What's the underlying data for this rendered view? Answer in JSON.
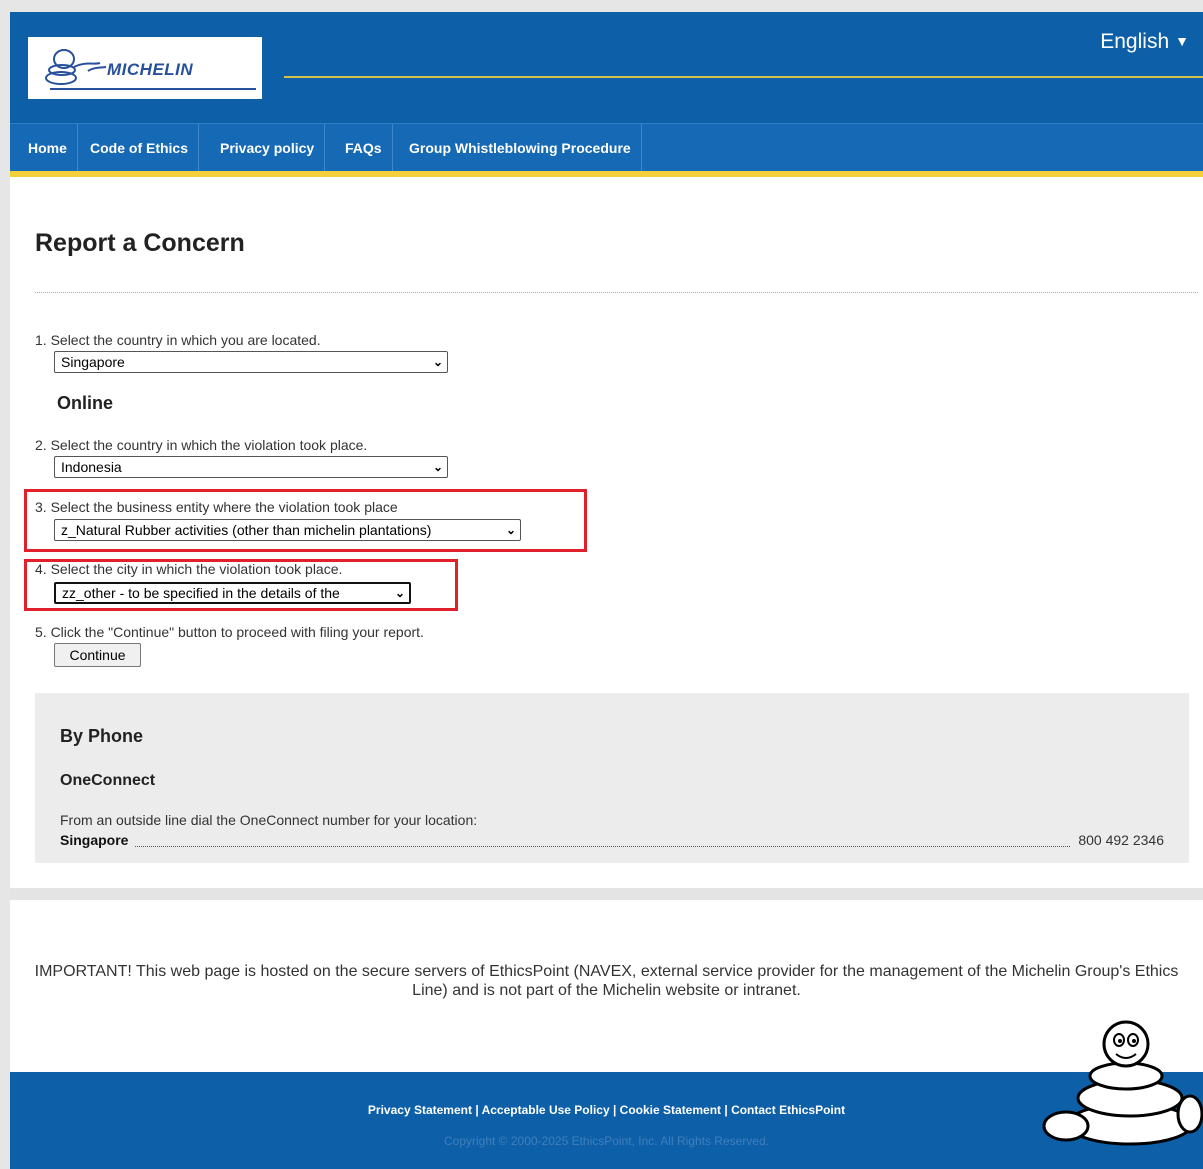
{
  "header": {
    "logo_text": "MICHELIN",
    "language": "English",
    "colors": {
      "brand_blue": "#0d5fa8",
      "accent_yellow": "#f3cf3a"
    }
  },
  "nav": {
    "items": [
      {
        "label": "Home"
      },
      {
        "label": "Code of Ethics"
      },
      {
        "label": "Privacy policy"
      },
      {
        "label": "FAQs"
      },
      {
        "label": "Group Whistleblowing Procedure"
      }
    ]
  },
  "main": {
    "title": "Report a Concern",
    "step1": {
      "text": "1. Select the country in which you are located.",
      "selected": "Singapore"
    },
    "online_heading": "Online",
    "step2": {
      "text": "2. Select the country in which the violation took place.",
      "selected": "Indonesia"
    },
    "step3": {
      "text": "3. Select the business entity where the violation took place",
      "selected": "z_Natural Rubber activities (other than michelin plantations)"
    },
    "step4": {
      "text": "4. Select the city in which the violation took place.",
      "selected": "zz_other - to be specified in the details of the"
    },
    "step5": {
      "text": "5. Click the \"Continue\" button to proceed with filing your report.",
      "button": "Continue"
    },
    "highlight_color": "#e0202a"
  },
  "phone": {
    "heading": "By Phone",
    "service": "OneConnect",
    "intro": "From an outside line dial the OneConnect number for your location:",
    "country": "Singapore",
    "number": "800 492 2346"
  },
  "notice": {
    "important": "IMPORTANT!",
    "text": " This web page is hosted on the secure servers of EthicsPoint (NAVEX, external service provider for the management of the Michelin Group's Ethics Line) and is not part of the Michelin website or intranet."
  },
  "footer": {
    "links": [
      {
        "label": "Privacy Statement"
      },
      {
        "label": "Acceptable Use Policy"
      },
      {
        "label": "Cookie Statement"
      },
      {
        "label": "Contact EthicsPoint"
      }
    ],
    "separator": " | ",
    "copyright": "Copyright © 2000-2025 EthicsPoint, Inc. All Rights Reserved."
  }
}
